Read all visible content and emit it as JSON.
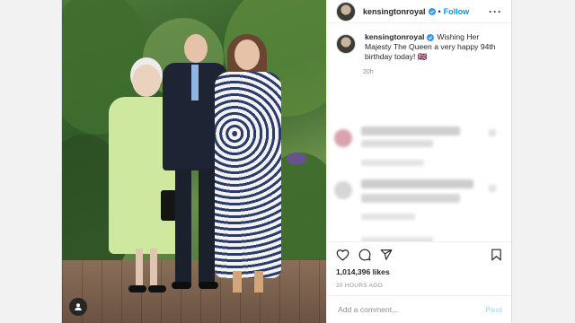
{
  "post": {
    "author": "kensingtonroyal",
    "follow_label": "Follow",
    "header_separator": "•",
    "more_label": "···",
    "caption": "Wishing Her Majesty The Queen a very happy 94th birthday today! 🇬🇧",
    "caption_time": "20h",
    "likes": "1,014,396 likes",
    "posted_ago": "20 HOURS AGO",
    "comment_placeholder": "Add a comment...",
    "post_button": "Post"
  },
  "icons": {
    "verified": "verified-badge-icon",
    "like": "heart-icon",
    "comment": "comment-bubble-icon",
    "share": "paper-plane-icon",
    "save": "bookmark-icon",
    "tagged_user": "user-tag-icon"
  },
  "colors": {
    "link_blue": "#0095f6",
    "verified_blue": "#3897f0",
    "text": "#262626",
    "muted": "#8e8e8e"
  }
}
